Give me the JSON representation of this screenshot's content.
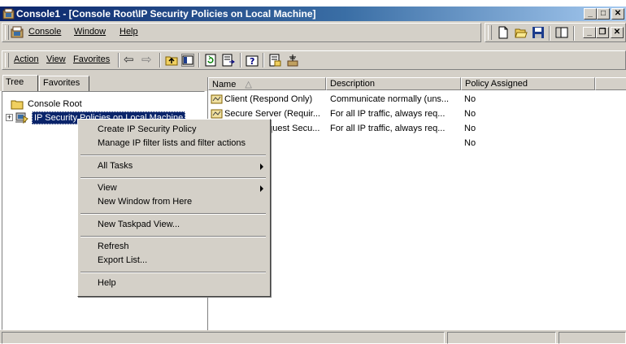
{
  "window": {
    "title": "Console1 - [Console Root\\IP Security Policies on Local Machine]",
    "minimize_glyph": "_",
    "maximize_glyph": "□",
    "close_glyph": "✕"
  },
  "menubar": {
    "console": "Console",
    "window": "Window",
    "help": "Help",
    "child_min": "_",
    "child_restore": "❐",
    "child_close": "✕"
  },
  "actionbar": {
    "action": "Action",
    "view": "View",
    "favorites": "Favorites",
    "back": "⇦",
    "forward": "⇨"
  },
  "tabs": {
    "tree": "Tree",
    "favorites": "Favorites"
  },
  "tree": {
    "root": "Console Root",
    "child": "IP Security Policies on Local Machine",
    "expander": "+"
  },
  "list": {
    "columns": [
      "Name",
      "Description",
      "Policy Assigned",
      ""
    ],
    "sort_indicator": "△",
    "rows": [
      {
        "name": "Client (Respond Only)",
        "description": "Communicate normally (uns...",
        "assigned": "No"
      },
      {
        "name": "Secure Server (Requir...",
        "description": "For all IP traffic, always req...",
        "assigned": "No"
      },
      {
        "name": "Server (Request Secu...",
        "description": "For all IP traffic, always req...",
        "assigned": "No"
      },
      {
        "name": "",
        "description": "",
        "assigned": "No"
      }
    ]
  },
  "context_menu": {
    "items": [
      "Create IP Security Policy",
      "Manage IP filter lists and filter actions",
      "All Tasks",
      "View",
      "New Window from Here",
      "New Taskpad View...",
      "Refresh",
      "Export List...",
      "Help"
    ]
  },
  "colors": {
    "title_start": "#0a246a",
    "title_end": "#a6caf0",
    "face": "#d4d0c8",
    "selection": "#0a246a"
  }
}
